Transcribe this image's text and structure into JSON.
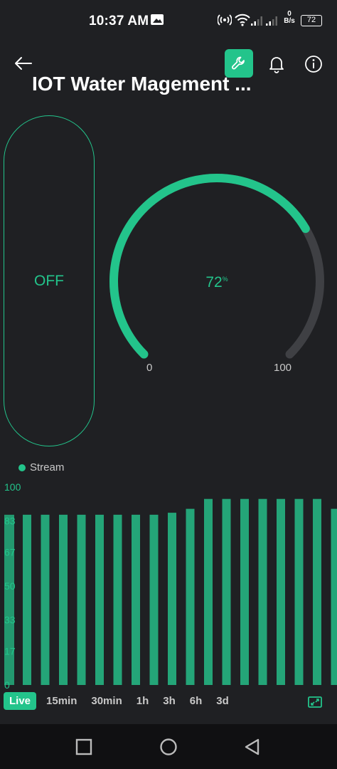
{
  "status_bar": {
    "time": "10:37 AM",
    "net_speed_value": "0",
    "net_speed_unit": "B/s",
    "battery": "72",
    "icons": [
      "photo-icon",
      "hotspot-icon",
      "wifi-icon",
      "signal-icon",
      "signal-icon",
      "battery-icon"
    ]
  },
  "header": {
    "title": "IOT Water Magement ...",
    "icons": [
      "back-arrow-icon",
      "wrench-icon",
      "bell-icon",
      "info-icon"
    ]
  },
  "switch": {
    "label": "OFF"
  },
  "gauge": {
    "value": "72",
    "unit": "%",
    "value_fraction": 0.72,
    "min_label": "0",
    "max_label": "100"
  },
  "chart_data": {
    "type": "bar",
    "legend_position": "top-left",
    "series": [
      {
        "name": "Stream",
        "values": [
          86,
          86,
          86,
          86,
          86,
          86,
          86,
          86,
          87,
          89,
          94,
          94,
          94,
          94,
          94,
          94,
          94,
          89,
          77
        ]
      }
    ],
    "y_ticks": [
      "0",
      "17",
      "33",
      "50",
      "67",
      "83",
      "100"
    ],
    "ylim": [
      0,
      100
    ],
    "grid": false
  },
  "time_ranges": [
    "Live",
    "15min",
    "30min",
    "1h",
    "3h",
    "6h",
    "3d"
  ],
  "active_range": "Live",
  "nav_bar": {
    "icons": [
      "recent-apps-icon",
      "home-icon",
      "back-icon"
    ]
  },
  "colors": {
    "accent": "#23c48b",
    "bar": "#24a578",
    "background": "#1f2023",
    "gauge_track": "#3f4044",
    "navbar": "#101012"
  }
}
